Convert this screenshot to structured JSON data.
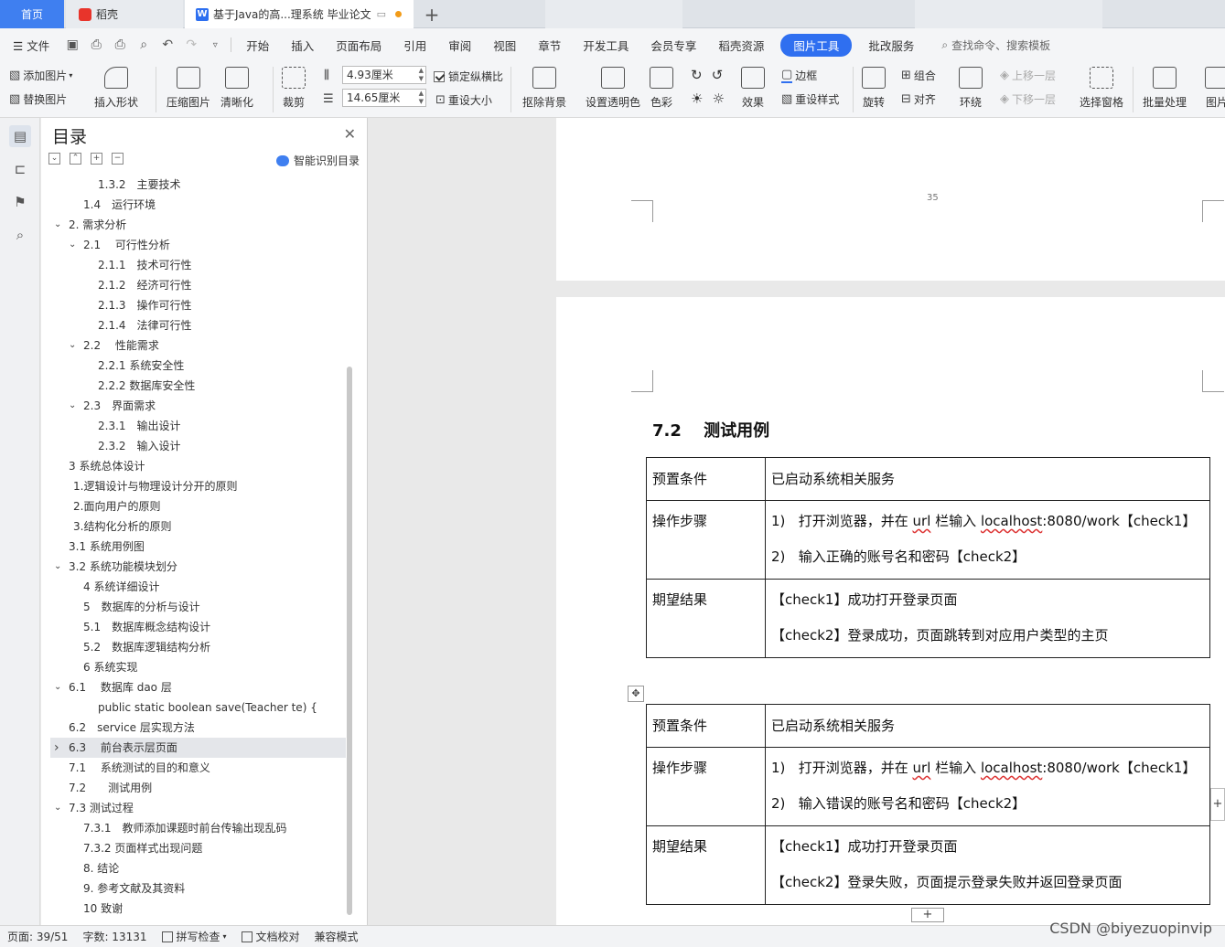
{
  "tabs": {
    "home": "首页",
    "daoke": "稻壳",
    "doc": "基于Java的高...理系统 毕业论文"
  },
  "menu": {
    "file": "文件",
    "items": [
      "开始",
      "插入",
      "页面布局",
      "引用",
      "审阅",
      "视图",
      "章节",
      "开发工具",
      "会员专享",
      "稻壳资源"
    ],
    "active": "图片工具",
    "after": "批改服务",
    "search": "查找命令、搜索模板"
  },
  "ribbon": {
    "add_image": "添加图片",
    "replace_image": "替换图片",
    "insert_shape": "插入形状",
    "compress": "压缩图片",
    "sharpen": "清晰化",
    "crop": "裁剪",
    "width": "4.93厘米",
    "height": "14.65厘米",
    "lock_ratio": "锁定纵横比",
    "reset_size": "重设大小",
    "remove_bg": "抠除背景",
    "set_transparent": "设置透明色",
    "color": "色彩",
    "effects": "效果",
    "border": "边框",
    "reset_style": "重设样式",
    "rotate": "旋转",
    "group": "组合",
    "align": "对齐",
    "wrap": "环绕",
    "bring_forward": "上移一层",
    "send_backward": "下移一层",
    "selection_pane": "选择窗格",
    "batch": "批量处理",
    "image": "图片"
  },
  "toc": {
    "title": "目录",
    "ai": "智能识别目录",
    "items": [
      {
        "text": "1.3.2　主要技术",
        "indent": 62,
        "chev": ""
      },
      {
        "text": "1.4　运行环境",
        "indent": 46,
        "chev": ""
      },
      {
        "text": "2. 需求分析",
        "indent": 30,
        "chev": "v"
      },
      {
        "text": "2.1　 可行性分析",
        "indent": 46,
        "chev": "v"
      },
      {
        "text": "2.1.1　技术可行性",
        "indent": 62,
        "chev": ""
      },
      {
        "text": "2.1.2　经济可行性",
        "indent": 62,
        "chev": ""
      },
      {
        "text": "2.1.3　操作可行性",
        "indent": 62,
        "chev": ""
      },
      {
        "text": "2.1.4　法律可行性",
        "indent": 62,
        "chev": ""
      },
      {
        "text": "2.2　 性能需求",
        "indent": 46,
        "chev": "v"
      },
      {
        "text": "2.2.1 系统安全性",
        "indent": 62,
        "chev": ""
      },
      {
        "text": "2.2.2 数据库安全性",
        "indent": 62,
        "chev": ""
      },
      {
        "text": "2.3　界面需求",
        "indent": 46,
        "chev": "v"
      },
      {
        "text": "2.3.1　输出设计",
        "indent": 62,
        "chev": ""
      },
      {
        "text": "2.3.2　输入设计",
        "indent": 62,
        "chev": ""
      },
      {
        "text": "3  系统总体设计",
        "indent": 30,
        "chev": ""
      },
      {
        "text": "1.逻辑设计与物理设计分开的原则",
        "indent": 35,
        "chev": ""
      },
      {
        "text": "2.面向用户的原则",
        "indent": 35,
        "chev": ""
      },
      {
        "text": "3.结构化分析的原则",
        "indent": 35,
        "chev": ""
      },
      {
        "text": "3.1  系统用例图",
        "indent": 30,
        "chev": ""
      },
      {
        "text": "3.2  系统功能模块划分",
        "indent": 30,
        "chev": "v"
      },
      {
        "text": "4  系统详细设计",
        "indent": 46,
        "chev": ""
      },
      {
        "text": "5　数据库的分析与设计",
        "indent": 46,
        "chev": ""
      },
      {
        "text": "5.1　数据库概念结构设计",
        "indent": 46,
        "chev": ""
      },
      {
        "text": "5.2　数据库逻辑结构分析",
        "indent": 46,
        "chev": ""
      },
      {
        "text": "6  系统实现",
        "indent": 46,
        "chev": ""
      },
      {
        "text": "6.1　 数据库 dao 层",
        "indent": 30,
        "chev": "v"
      },
      {
        "text": "public static boolean save(Teacher te) {",
        "indent": 62,
        "chev": ""
      },
      {
        "text": "6.2　service 层实现方法",
        "indent": 30,
        "chev": ""
      },
      {
        "text": "6.3　 前台表示层页面",
        "indent": 30,
        "chev": ">",
        "selected": true
      },
      {
        "text": "7.1　 系统测试的目的和意义",
        "indent": 30,
        "chev": ""
      },
      {
        "text": "7.2　　测试用例",
        "indent": 30,
        "chev": ""
      },
      {
        "text": "7.3  测试过程",
        "indent": 30,
        "chev": "v"
      },
      {
        "text": "7.3.1　教师添加课题时前台传输出现乱码",
        "indent": 46,
        "chev": ""
      },
      {
        "text": "7.3.2 页面样式出现问题",
        "indent": 46,
        "chev": ""
      },
      {
        "text": "8. 结论",
        "indent": 46,
        "chev": ""
      },
      {
        "text": "9. 参考文献及其资料",
        "indent": 46,
        "chev": ""
      },
      {
        "text": "10  致谢",
        "indent": 46,
        "chev": ""
      }
    ]
  },
  "doc": {
    "page_number": "35",
    "heading": "7.2　 测试用例",
    "table1": {
      "pre_label": "预置条件",
      "pre_value": "已启动系统相关服务",
      "steps_label": "操作步骤",
      "step1_num": "1)",
      "step1_a": "打开浏览器，并在",
      "step1_url": "url",
      "step1_b": "栏输入",
      "step1_host": "localhost",
      "step1_c": ":8080/work【check1】",
      "step2_num": "2)",
      "step2": "输入正确的账号名和密码【check2】",
      "expect_label": "期望结果",
      "expect1": "【check1】成功打开登录页面",
      "expect2": "【check2】登录成功，页面跳转到对应用户类型的主页"
    },
    "table2": {
      "pre_label": "预置条件",
      "pre_value": "已启动系统相关服务",
      "steps_label": "操作步骤",
      "step1_num": "1)",
      "step1_a": "打开浏览器，并在",
      "step1_url": "url",
      "step1_b": "栏输入",
      "step1_host": "localhost",
      "step1_c": ":8080/work【check1】",
      "step2_num": "2)",
      "step2": "输入错误的账号名和密码【check2】",
      "expect_label": "期望结果",
      "expect1": "【check1】成功打开登录页面",
      "expect2": "【check2】登录失败，页面提示登录失败并返回登录页面"
    }
  },
  "status": {
    "page": "页面: 39/51",
    "words": "字数: 13131",
    "spell": "拼写检查",
    "proof": "文档校对",
    "compat": "兼容模式"
  },
  "watermark": "CSDN @biyezuopinvip",
  "colors": {
    "accent": "#2f6ff0",
    "home_tab": "#3f7ff0"
  }
}
